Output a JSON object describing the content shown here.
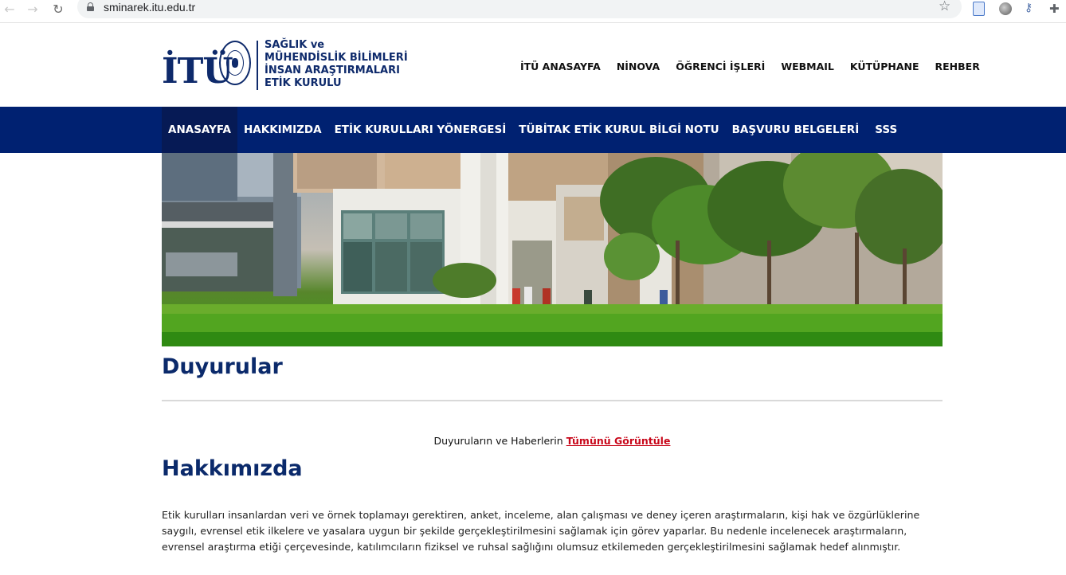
{
  "browser": {
    "url": "sminarek.itu.edu.tr",
    "icons": [
      "back-icon",
      "forward-icon",
      "reload-icon",
      "lock-icon",
      "star-icon",
      "extension-doc-icon",
      "extension-circle-icon",
      "extension-key-icon",
      "puzzle-icon"
    ]
  },
  "header": {
    "logo_mark": "İTÜ",
    "logo_lines": [
      "SAĞLIK ve",
      "MÜHENDİSLİK BİLİMLERİ",
      "İNSAN ARAŞTIRMALARI",
      "ETİK KURULU"
    ],
    "top_links": [
      "İTÜ ANASAYFA",
      "NİNOVA",
      "ÖĞRENCİ İŞLERİ",
      "WEBMAIL",
      "KÜTÜPHANE",
      "REHBER"
    ]
  },
  "nav": {
    "items": [
      "ANASAYFA",
      "HAKKIMIZDA",
      "ETİK KURULLARI YÖNERGESİ",
      "TÜBİTAK ETİK KURUL BİLGİ NOTU",
      "BAŞVURU BELGELERİ",
      "SSS"
    ],
    "active_index": 0
  },
  "announcements": {
    "heading": "Duyurular",
    "line_prefix": "Duyuruların ve Haberlerin",
    "link": "Tümünü Görüntüle"
  },
  "about": {
    "heading": "Hakkımızda",
    "text": "Etik kurulları insanlardan veri ve örnek toplamayı gerektiren, anket, inceleme, alan çalışması ve deney içeren araştırmaların, kişi hak ve özgürlüklerine saygılı, evrensel etik ilkelere ve yasalara uygun bir şekilde gerçekleştirilmesini sağlamak için görev yaparlar. Bu nedenle incelenecek araştırmaların, evrensel araştırma etiği çerçevesinde, katılımcıların fiziksel ve ruhsal sağlığını olumsuz etkilemeden gerçekleştirilmesini sağlamak hedef alınmıştır."
  },
  "colors": {
    "nav_bg": "#002171",
    "heading": "#0b2a6b",
    "link_red": "#c8081b"
  }
}
